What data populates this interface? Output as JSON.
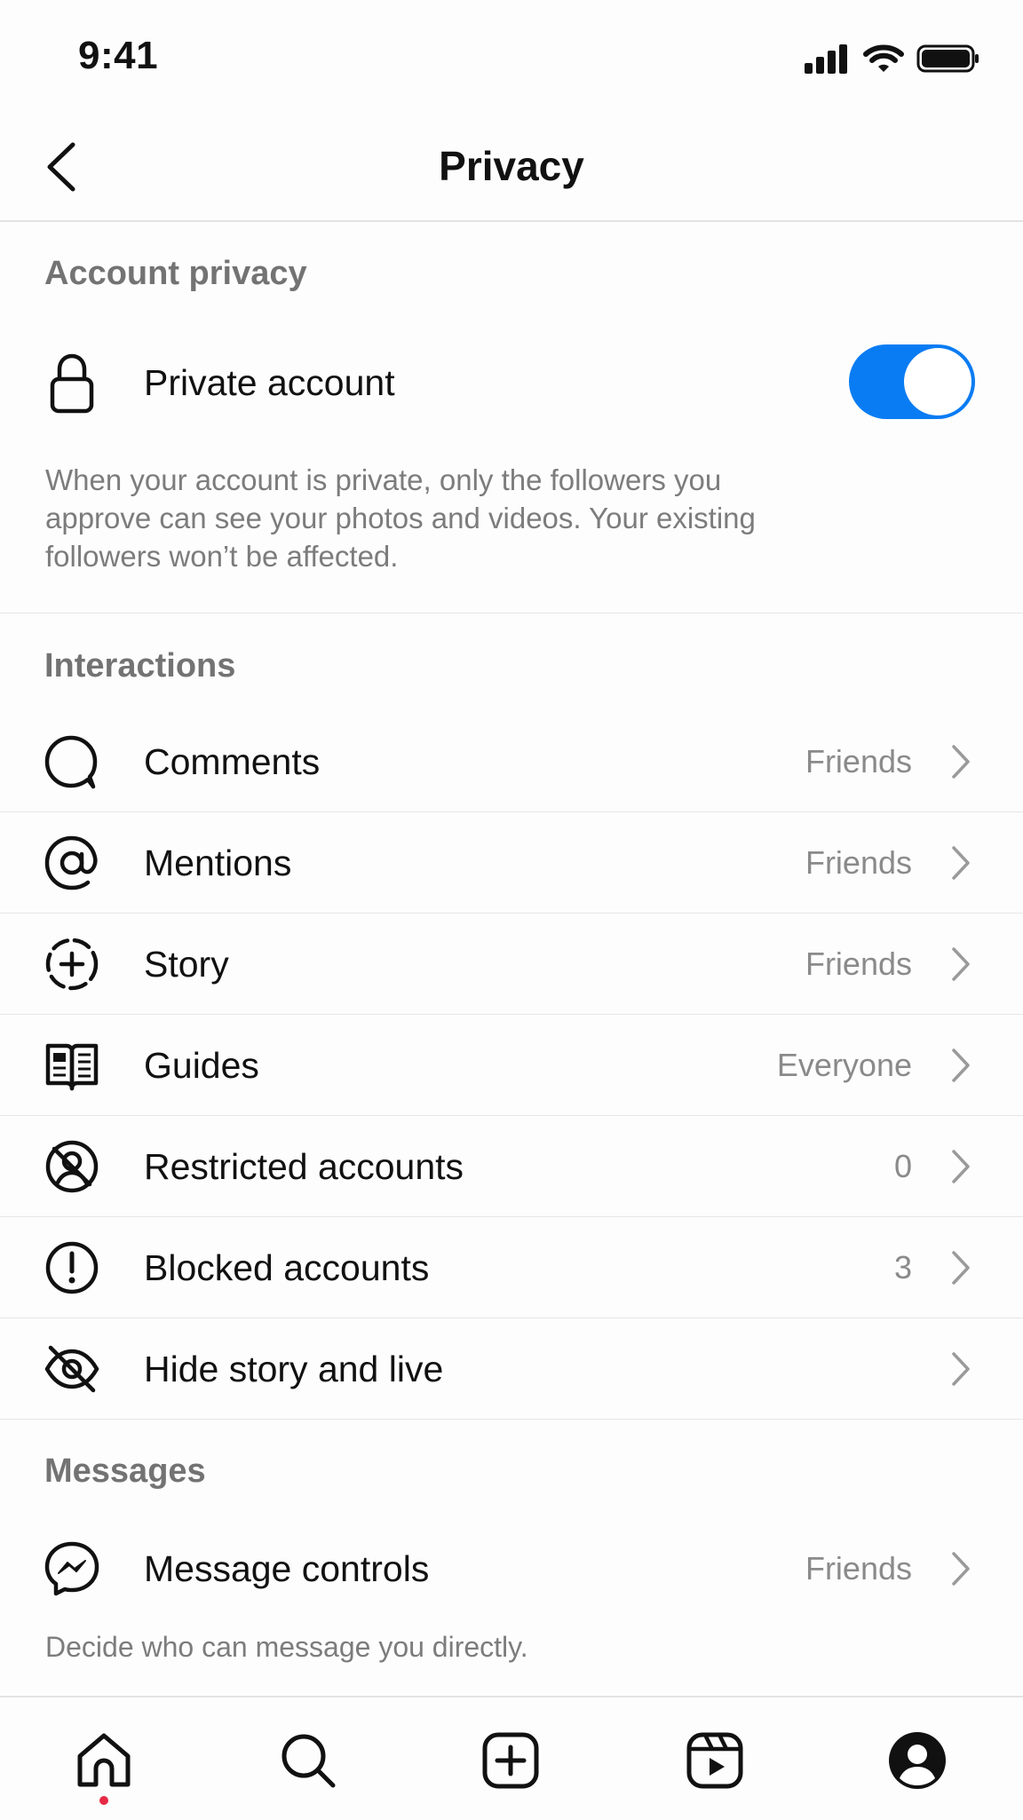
{
  "status_bar": {
    "time": "9:41"
  },
  "header": {
    "title": "Privacy"
  },
  "account_privacy": {
    "section_title": "Account privacy",
    "private_account_label": "Private account",
    "private_account_enabled": true,
    "description": "When your account is private, only the followers you approve can see your photos and videos. Your existing followers won’t be affected."
  },
  "interactions": {
    "section_title": "Interactions",
    "items": [
      {
        "label": "Comments",
        "value": "Friends",
        "icon": "comment-icon"
      },
      {
        "label": "Mentions",
        "value": "Friends",
        "icon": "at-icon"
      },
      {
        "label": "Story",
        "value": "Friends",
        "icon": "story-add-icon"
      },
      {
        "label": "Guides",
        "value": "Everyone",
        "icon": "guide-book-icon"
      },
      {
        "label": "Restricted accounts",
        "value": "0",
        "icon": "restricted-icon"
      },
      {
        "label": "Blocked accounts",
        "value": "3",
        "icon": "blocked-icon"
      },
      {
        "label": "Hide story and live",
        "value": "",
        "icon": "eye-off-icon"
      }
    ]
  },
  "messages": {
    "section_title": "Messages",
    "message_controls_label": "Message controls",
    "message_controls_value": "Friends",
    "description": "Decide who can message you directly."
  },
  "colors": {
    "accent": "#0a7cf3",
    "notification_dot": "#e62a45",
    "secondary_text": "#7c7c7c"
  },
  "tab_bar": {
    "tabs": [
      "home-icon",
      "search-icon",
      "create-icon",
      "reels-icon",
      "profile-icon"
    ],
    "active": "home-icon"
  }
}
